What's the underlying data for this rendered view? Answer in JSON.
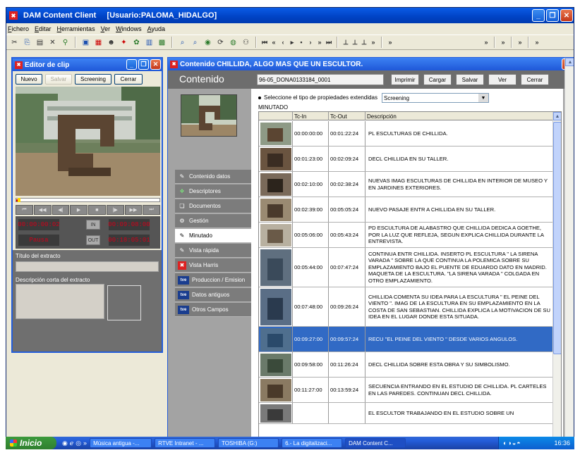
{
  "app": {
    "title": "DAM Content Client     [Usuario:PALOMA_HIDALGO]",
    "logo": "DAM-logo",
    "window_buttons": [
      "_",
      "❐",
      "✕"
    ]
  },
  "menu": [
    "Fichero",
    "Editar",
    "Herramientas",
    "Ver",
    "Windows",
    "Ayuda"
  ],
  "toolbar": {
    "more": "»"
  },
  "clip_editor": {
    "title": "Editor de clip",
    "buttons": {
      "nuevo": "Nuevo",
      "salvar": "Salvar",
      "screening": "Screening",
      "cerrar": "Cerrar"
    },
    "progress_fraction": 0.02,
    "transport": [
      "⏮",
      "◀◀",
      "◀|",
      "▶",
      "■",
      "|▶",
      "▶▶",
      "⏭"
    ],
    "tc_current": "00:00:00:02",
    "tc_in": "00:09:08:00",
    "tc_state": "Pausa",
    "tc_out": "00:18:05:01",
    "btn_in": "IN",
    "btn_out": "OUT",
    "titulo_label": "Título del extracto",
    "descripcion_label": "Descripción corta del extracto"
  },
  "content_window": {
    "title": "Contenido CHILLIDA, ALGO MAS QUE UN ESCULTOR.",
    "header_title": "Contenido",
    "id": "96-05_DONA0133184_0001",
    "buttons": [
      "Imprimir",
      "Cargar",
      "Salvar",
      "Ver",
      "Cerrar"
    ],
    "nav": [
      {
        "label": "Contenido datos",
        "icon": "edit-icon"
      },
      {
        "label": "Descriptores",
        "icon": "tree-icon"
      },
      {
        "label": "Documentos",
        "icon": "docs-icon"
      },
      {
        "label": "Gestión",
        "icon": "gear-icon"
      },
      {
        "label": "Minutado",
        "icon": "edit-icon"
      },
      {
        "label": "Vista rápida",
        "icon": "edit-icon"
      },
      {
        "label": "Vista Harris",
        "icon": "harris-icon"
      },
      {
        "label": "Produccion / Emision",
        "icon": "tve-icon"
      },
      {
        "label": "Datos antiguos",
        "icon": "tve-icon"
      },
      {
        "label": "Otros Campos",
        "icon": "tve-icon"
      }
    ],
    "active_nav": "Minutado",
    "tve_badge": "tve",
    "props_label": "Seleccione el tipo de propiedades extendidas",
    "props_value": "Screening",
    "section": "MINUTADO",
    "columns": [
      "Tc-In",
      "Tc-Out",
      "Descripción"
    ],
    "rows": [
      {
        "in": "00:00:00:00",
        "out": "00:01:22:24",
        "desc": "PL ESCULTURAS DE CHILLIDA."
      },
      {
        "in": "00:01:23:00",
        "out": "00:02:09:24",
        "desc": "DECL CHILLIDA EN SU TALLER."
      },
      {
        "in": "00:02:10:00",
        "out": "00:02:38:24",
        "desc": "NUEVAS IMAG ESCULTURAS DE CHILLIDA EN INTERIOR DE MUSEO Y EN JARDINES EXTERIORES."
      },
      {
        "in": "00:02:39:00",
        "out": "00:05:05:24",
        "desc": "NUEVO PASAJE ENTR A CHILLIDA EN SU TALLER."
      },
      {
        "in": "00:05:06:00",
        "out": "00:05:43:24",
        "desc": "PD ESCULTURA DE ALABASTRO QUE CHILLIDA DEDICA A GOETHE, POR LA LUZ QUE REFLEJA, SEGUN EXPLICA CHILLIDA DURANTE LA ENTREVISTA."
      },
      {
        "in": "00:05:44:00",
        "out": "00:07:47:24",
        "desc": "CONTINUA ENTR CHILLIDA. INSERTO PL ESCULTURA \" LA SIRENA VARADA \" SOBRE LA QUE CONTINUA LA POLEMICA SOBRE SU EMPLAZAMIENTO BAJO EL PUENTE DE EDUARDO DATO EN MADRID. MAQUETA DE LA ESCULTURA. \"LA SIRENA VARADA \" COLGADA EN OTRO EMPLAZAMIENTO."
      },
      {
        "in": "00:07:48:00",
        "out": "00:09:26:24",
        "desc": "CHILLIDA COMENTA SU IDEA PARA LA ESCULTURA \" EL PEINE DEL VIENTO \". IMAG DE LA ESCULTURA EN SU EMPLAZAMIENTO EN LA COSTA DE SAN SEBASTIAN. CHILLIDA EXPLICA LA MOTIVACION DE SU IDEA EN EL LUGAR DONDE ESTA SITUADA."
      },
      {
        "in": "00:09:27:00",
        "out": "00:09:57:24",
        "desc": "RECU \"EL PEINE DEL VIENTO \" DESDE VARIOS ANGULOS.",
        "selected": true
      },
      {
        "in": "00:09:58:00",
        "out": "00:11:26:24",
        "desc": "DECL CHILLIDA SOBRE ESTA OBRA Y SU SIMBOLISMO."
      },
      {
        "in": "00:11:27:00",
        "out": "00:13:59:24",
        "desc": "SECUENCIA ENTRANDO EN EL ESTUDIO DE CHILLIDA. PL CARTELES EN LAS PAREDES. CONTINUAN DECL CHILLIDA."
      },
      {
        "in": "",
        "out": "",
        "desc": "EL ESCULTOR TRABAJANDO EN EL ESTUDIO SOBRE UN"
      }
    ]
  },
  "taskbar": {
    "start": "Inicio",
    "tasks": [
      "Música antigua -...",
      "RTVE Intranet - ...",
      "TOSHIBA (G:)",
      "6.- La digitalizaci...",
      "DAM Content C..."
    ],
    "clock": "16:36"
  },
  "colors": {
    "selection": "#316ac5",
    "xp_blue": "#245edb",
    "tc_red": "#d0001a"
  }
}
